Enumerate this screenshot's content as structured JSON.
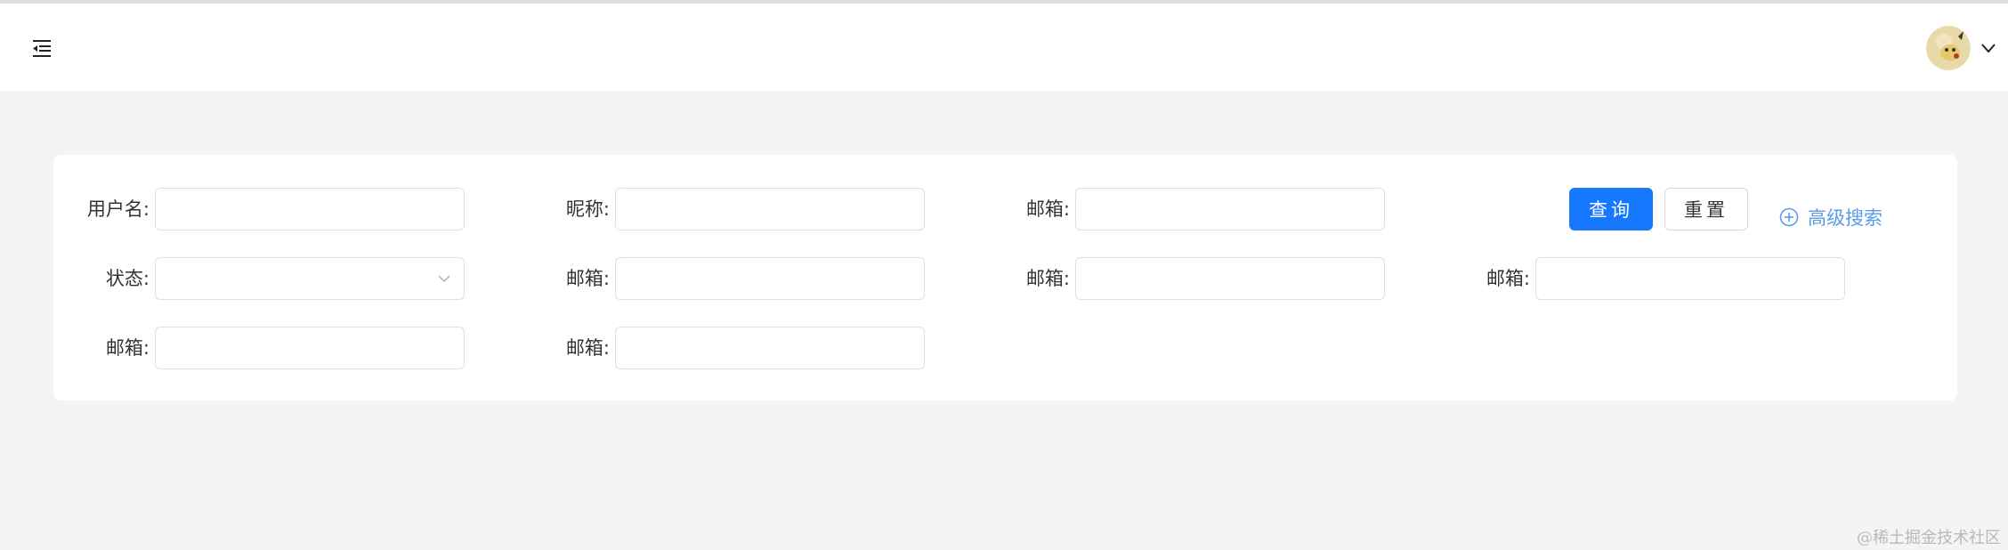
{
  "search": {
    "fields": [
      {
        "label": "用户名:",
        "value": ""
      },
      {
        "label": "昵称:",
        "value": ""
      },
      {
        "label": "邮箱:",
        "value": ""
      },
      {
        "label": "状态:",
        "value": ""
      },
      {
        "label": "邮箱:",
        "value": ""
      },
      {
        "label": "邮箱:",
        "value": ""
      },
      {
        "label": "邮箱:",
        "value": ""
      },
      {
        "label": "邮箱:",
        "value": ""
      },
      {
        "label": "邮箱:",
        "value": ""
      }
    ],
    "query_label": "查询",
    "reset_label": "重置",
    "advanced_label": "高级搜索"
  },
  "watermark": "@稀土掘金技术社区",
  "colors": {
    "primary": "#1677ff",
    "link": "#5a9bea",
    "background": "#f4f4f4"
  }
}
